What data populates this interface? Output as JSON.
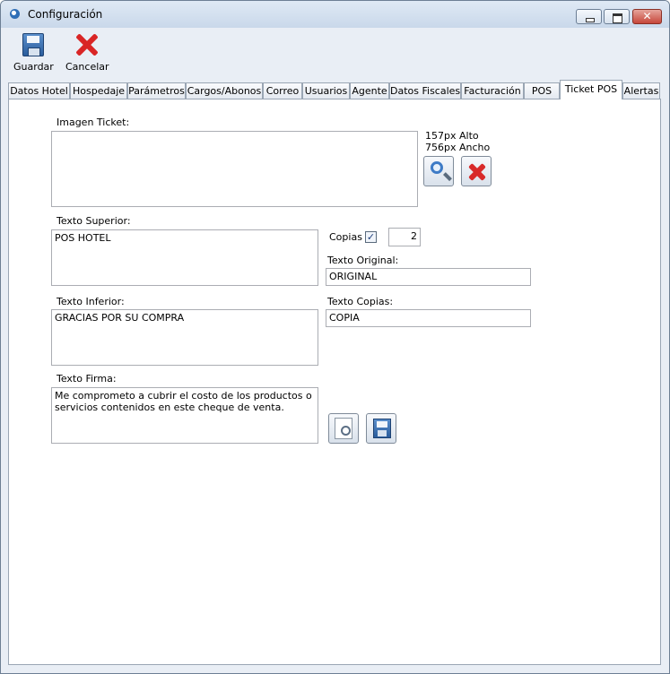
{
  "window": {
    "title": "Configuración",
    "close_glyph": "✕"
  },
  "toolbar": {
    "save_label": "Guardar",
    "cancel_label": "Cancelar"
  },
  "tabs": [
    {
      "label": "Datos Hotel"
    },
    {
      "label": "Hospedaje"
    },
    {
      "label": "Parámetros"
    },
    {
      "label": "Cargos/Abonos"
    },
    {
      "label": "Correo"
    },
    {
      "label": "Usuarios"
    },
    {
      "label": "Agente"
    },
    {
      "label": "Datos Fiscales"
    },
    {
      "label": "Facturación"
    },
    {
      "label": "POS"
    },
    {
      "label": "Ticket POS"
    },
    {
      "label": "Alertas"
    }
  ],
  "active_tab": "Ticket POS",
  "ticket": {
    "image_label": "Imagen Ticket:",
    "size_height": "157px Alto",
    "size_width": "756px Ancho",
    "top_text_label": "Texto Superior:",
    "top_text_value": "POS HOTEL",
    "copies_label": "Copias",
    "copies_checked": true,
    "check_glyph": "✓",
    "copies_value": "2",
    "original_label": "Texto Original:",
    "original_value": "ORIGINAL",
    "bottom_text_label": "Texto Inferior:",
    "bottom_text_value": "GRACIAS POR SU COMPRA",
    "copies_text_label": "Texto Copias:",
    "copies_text_value": "COPIA",
    "signature_label": "Texto Firma:",
    "signature_value": "Me comprometo a cubrir el costo de los productos o servicios contenidos en este cheque de venta."
  },
  "colors": {
    "window_bg": "#e9eef5",
    "delete_red": "#d82a2a",
    "accent_blue": "#3e7bc6"
  }
}
